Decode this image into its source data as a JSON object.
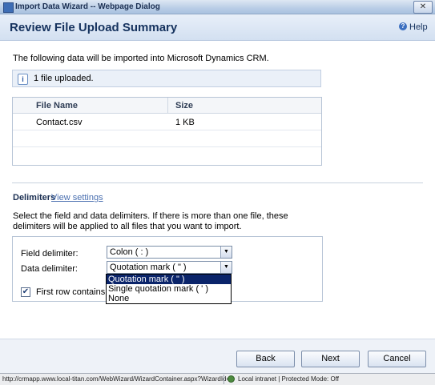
{
  "window": {
    "title": "Import Data Wizard -- Webpage Dialog",
    "close_glyph": "✕"
  },
  "header": {
    "title": "Review File Upload Summary",
    "help_glyph": "?",
    "help_label": "Help"
  },
  "intro_text": "The following data will be imported into Microsoft Dynamics CRM.",
  "status": {
    "icon_glyph": "i",
    "text": "1 file uploaded."
  },
  "file_table": {
    "columns": [
      "File Name",
      "Size"
    ],
    "rows": [
      {
        "name": "Contact.csv",
        "size": "1 KB"
      }
    ]
  },
  "delimiters": {
    "label": "Delimiters",
    "view_settings": "View settings",
    "description": "Select the field and data delimiters. If there is more than one file, these delimiters will be applied to all files that you want to import.",
    "field_label": "Field delimiter:",
    "field_value": "Colon ( : )",
    "data_label": "Data delimiter:",
    "data_value": "Quotation mark ( \" )",
    "first_row_label": "First row contains co",
    "first_row_checked": true,
    "check_glyph": "✔",
    "arrow_glyph": "▼",
    "options": [
      "Quotation mark ( \" )",
      "Single quotation mark ( ' )",
      "None"
    ],
    "selected_option": 0
  },
  "buttons": {
    "back": "Back",
    "next": "Next",
    "cancel": "Cancel"
  },
  "statusbar": {
    "url": "http://crmapp.www.local-titan.com/WebWizard/WizardContainer.aspx?WizardId=",
    "zone": "Local intranet | Protected Mode: Off"
  },
  "icons": {
    "window": "dialog-icon",
    "help": "help-icon",
    "info": "info-icon",
    "zone": "globe-icon"
  }
}
